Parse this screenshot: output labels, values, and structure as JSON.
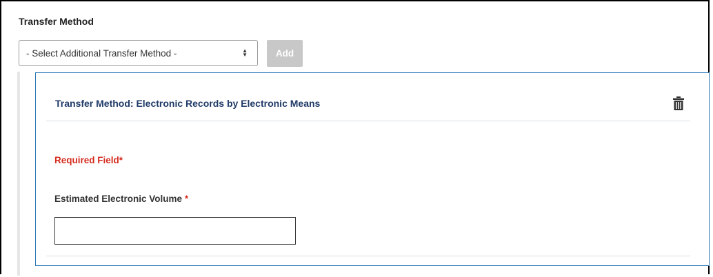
{
  "section": {
    "title": "Transfer Method"
  },
  "transfer_select": {
    "selected_label": "- Select Additional Transfer Method -",
    "icon": "sort-arrows-icon"
  },
  "add_button": {
    "label": "Add",
    "disabled": true
  },
  "method_card": {
    "title": "Transfer Method: Electronic Records by Electronic Means",
    "delete_icon": "trash-icon",
    "required_note": "Required Field*",
    "field": {
      "label": "Estimated Electronic Volume",
      "required_marker": "*",
      "value": "",
      "placeholder": ""
    }
  },
  "colors": {
    "card_border": "#2e79b5",
    "card_title": "#1f3a67",
    "required": "#d52b1e",
    "button_disabled": "#c8c8c8"
  }
}
